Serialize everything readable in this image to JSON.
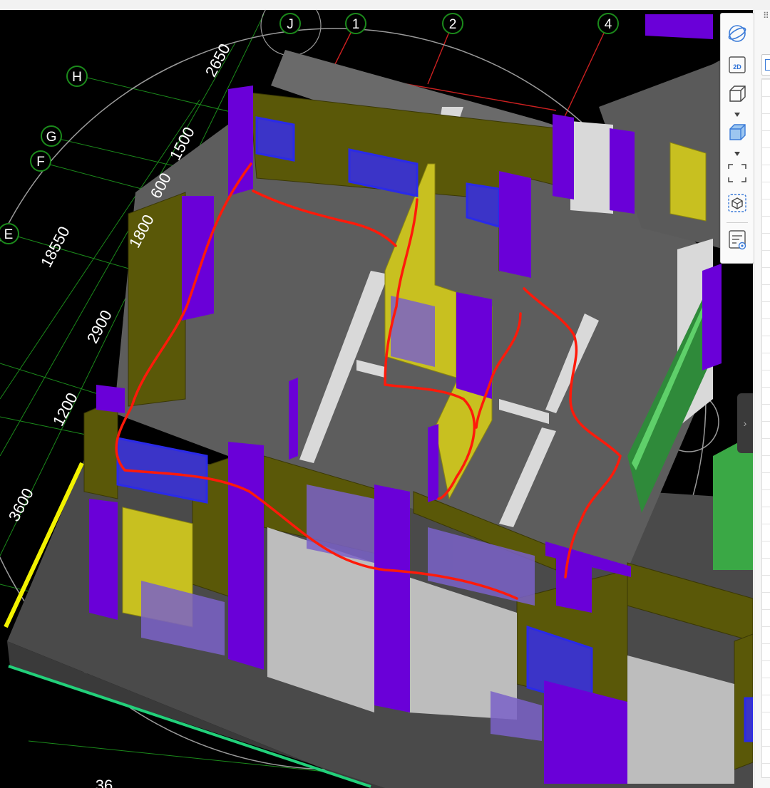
{
  "viewport": {
    "axis_labels": [
      "J",
      "1",
      "2",
      "4",
      "H",
      "G",
      "F",
      "E"
    ],
    "dimension_labels": [
      "2650",
      "1500",
      "600",
      "1800",
      "18550",
      "2900",
      "1200",
      "3600",
      "36"
    ]
  },
  "toolbar": {
    "buttons": [
      {
        "name": "orbit-icon"
      },
      {
        "name": "view-2d-icon",
        "label": "2D"
      },
      {
        "name": "wireframe-box-icon"
      },
      {
        "name": "solid-box-icon"
      },
      {
        "name": "zoom-extents-icon"
      },
      {
        "name": "isolate-object-icon"
      },
      {
        "name": "properties-icon"
      }
    ]
  },
  "panel": {
    "collapse_glyph": "›",
    "grip_glyph": "⠿"
  },
  "colors": {
    "grid_line": "#1b8a1b",
    "axis_line": "#cc2020",
    "column": "#6a00d8",
    "wall": "#5a5808",
    "slab": "#5d5d5d",
    "window_glass": "#2a2ad6",
    "annotation_stroke": "#ff1a0a"
  }
}
